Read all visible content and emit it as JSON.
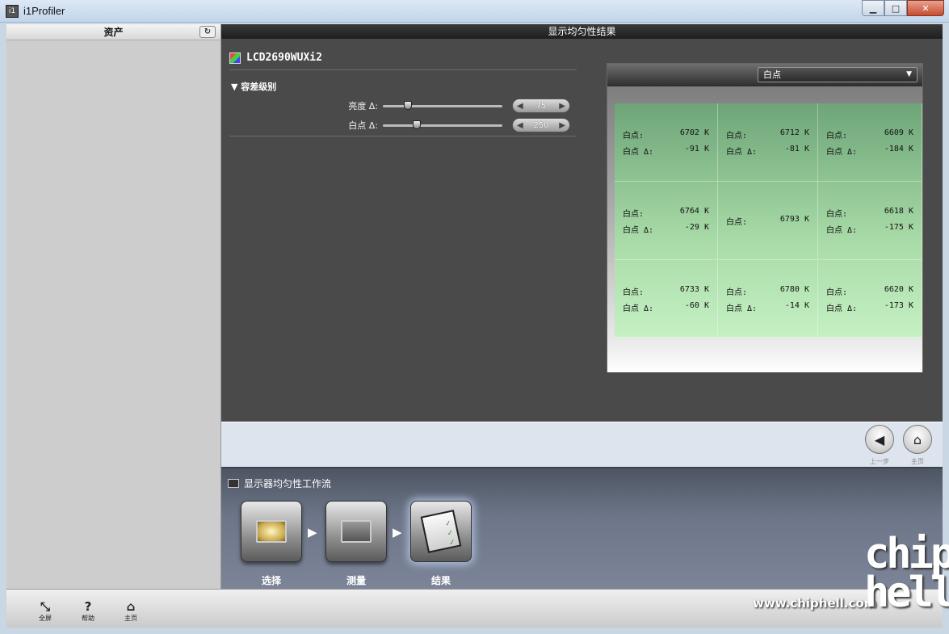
{
  "window": {
    "title": "i1Profiler",
    "icon": "app-icon",
    "buttons": [
      "minimize",
      "maximize",
      "close"
    ]
  },
  "left_pane": {
    "title": "资产",
    "refresh_icon": "refresh-icon"
  },
  "main": {
    "header": "显示均匀性结果",
    "device_name": "LCD2690WUXi2",
    "tolerance": {
      "title": "▼ 容差级别",
      "brightness": {
        "label": "亮度 Δ:",
        "value": "75",
        "level": 0.19
      },
      "whitepoint": {
        "label": "白点 Δ:",
        "value": "250",
        "level": 0.27
      }
    },
    "result": {
      "selected_metric": "白点",
      "cells": [
        {
          "a_label": "白点:",
          "a_value": "6702 K",
          "b_label": "白点 Δ:",
          "b_value": "-91 K"
        },
        {
          "a_label": "白点:",
          "a_value": "6712 K",
          "b_label": "白点 Δ:",
          "b_value": "-81 K"
        },
        {
          "a_label": "白点:",
          "a_value": "6609 K",
          "b_label": "白点 Δ:",
          "b_value": "-184 K"
        },
        {
          "a_label": "白点:",
          "a_value": "6764 K",
          "b_label": "白点 Δ:",
          "b_value": "-29 K"
        },
        {
          "a_label": "白点:",
          "a_value": "6793 K"
        },
        {
          "a_label": "白点:",
          "a_value": "6618 K",
          "b_label": "白点 Δ:",
          "b_value": "-175 K"
        },
        {
          "a_label": "白点:",
          "a_value": "6733 K",
          "b_label": "白点 Δ:",
          "b_value": "-60 K"
        },
        {
          "a_label": "白点:",
          "a_value": "6780 K",
          "b_label": "白点 Δ:",
          "b_value": "-14 K"
        },
        {
          "a_label": "白点:",
          "a_value": "6620 K",
          "b_label": "白点 Δ:",
          "b_value": "-173 K"
        }
      ]
    }
  },
  "nav": {
    "back_label": "上一步",
    "home_label": "主页"
  },
  "workflow": {
    "title": "显示器均匀性工作流",
    "steps": [
      {
        "label": "选择"
      },
      {
        "label": "测量"
      },
      {
        "label": "结果"
      }
    ]
  },
  "bottom_bar": {
    "fullscreen": "全屏",
    "help": "帮助",
    "home": "主页"
  },
  "watermark": {
    "url": "www.chiphell.com",
    "logo": "chip hell"
  }
}
